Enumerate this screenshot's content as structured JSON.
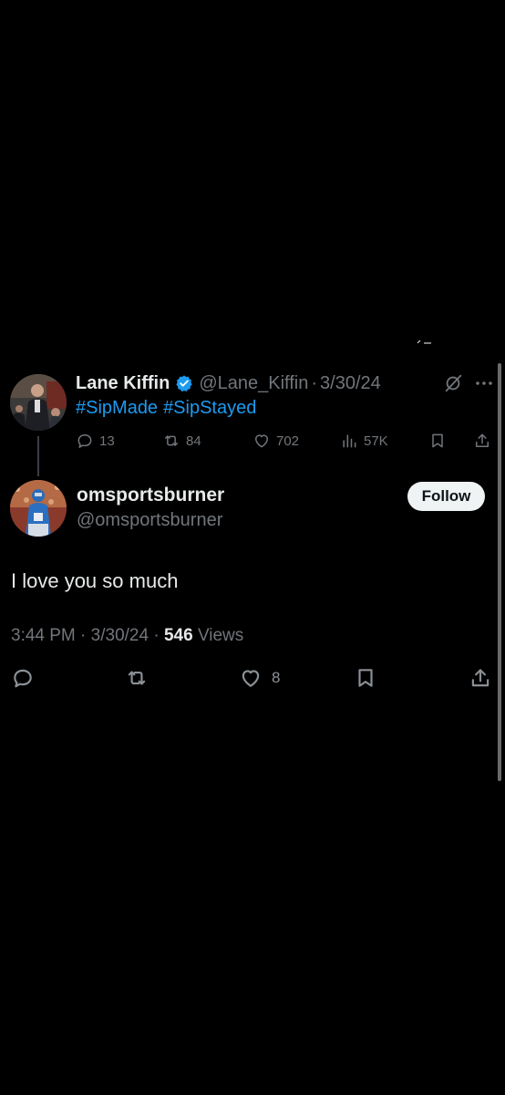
{
  "colors": {
    "background": "#000000",
    "text_primary": "#e7e9ea",
    "text_secondary": "#71767b",
    "link": "#1d9bf0",
    "verified": "#1d9bf0",
    "follow_button_bg": "#eff3f4"
  },
  "parent_tweet": {
    "name": "Lane Kiffin",
    "verified": true,
    "handle": "@Lane_Kiffin",
    "separator": "·",
    "date": "3/30/24",
    "hashtags": [
      "#SipMade",
      "#SipStayed"
    ],
    "actions": {
      "replies": "13",
      "reposts": "84",
      "likes": "702",
      "views": "57K"
    },
    "icons": [
      "grok-icon",
      "more-icon",
      "reply-icon",
      "repost-icon",
      "like-icon",
      "views-icon",
      "bookmark-icon",
      "share-icon"
    ]
  },
  "main_tweet": {
    "name": "omsportsburner",
    "handle": "@omsportsburner",
    "follow_label": "Follow",
    "text": "I love you so much",
    "time": "3:44 PM",
    "separator": "·",
    "date": "3/30/24",
    "views_count": "546",
    "views_label": "Views",
    "actions": {
      "likes": "8"
    },
    "icons": [
      "reply-icon",
      "repost-icon",
      "like-icon",
      "bookmark-icon",
      "share-icon"
    ]
  }
}
